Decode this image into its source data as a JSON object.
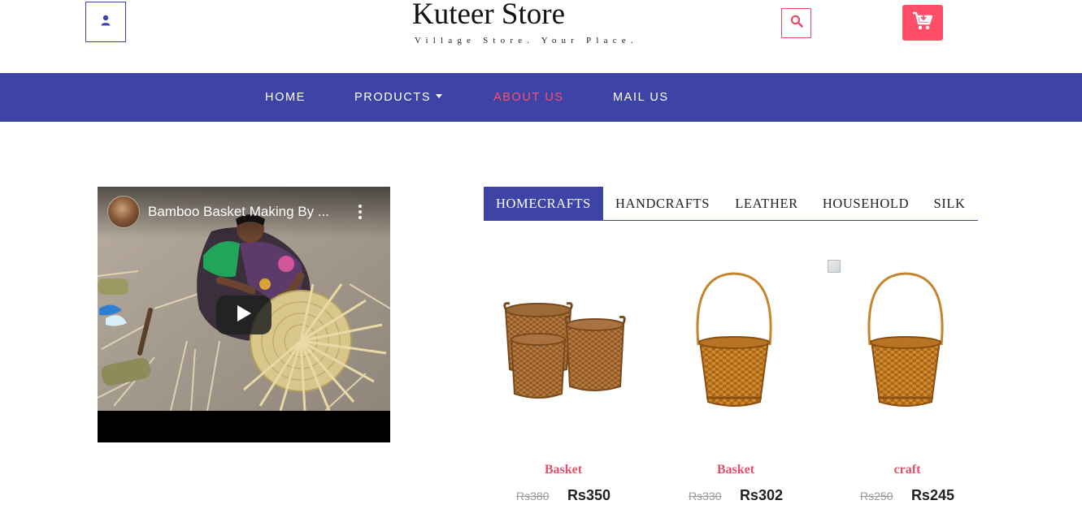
{
  "header": {
    "brand_title": "Kuteer Store",
    "brand_tagline": "Village Store. Your Place.",
    "user_icon": "user-icon",
    "search_icon": "search-icon",
    "cart_icon": "cart-icon",
    "accent_color": "#ff4e67"
  },
  "nav": {
    "background": "#3d44a5",
    "items": [
      {
        "label": "HOME"
      },
      {
        "label": "PRODUCTS"
      },
      {
        "label": "ABOUT US"
      },
      {
        "label": "MAIL US"
      }
    ],
    "active": "ABOUT US"
  },
  "video": {
    "title": "Bamboo Basket Making By ...",
    "play_icon": "play-icon",
    "menu_icon": "kebab-menu-icon"
  },
  "tabs": {
    "items": [
      {
        "label": "HOMECRAFTS"
      },
      {
        "label": "HANDCRAFTS"
      },
      {
        "label": "LEATHER"
      },
      {
        "label": "HOUSEHOLD"
      },
      {
        "label": "SILK"
      }
    ],
    "active": "HOMECRAFTS"
  },
  "products": [
    {
      "name": "Basket",
      "old_price": "Rs380",
      "price": "Rs350"
    },
    {
      "name": "Basket",
      "old_price": "Rs330",
      "price": "Rs302"
    },
    {
      "name": "craft",
      "old_price": "Rs250",
      "price": "Rs245"
    }
  ]
}
